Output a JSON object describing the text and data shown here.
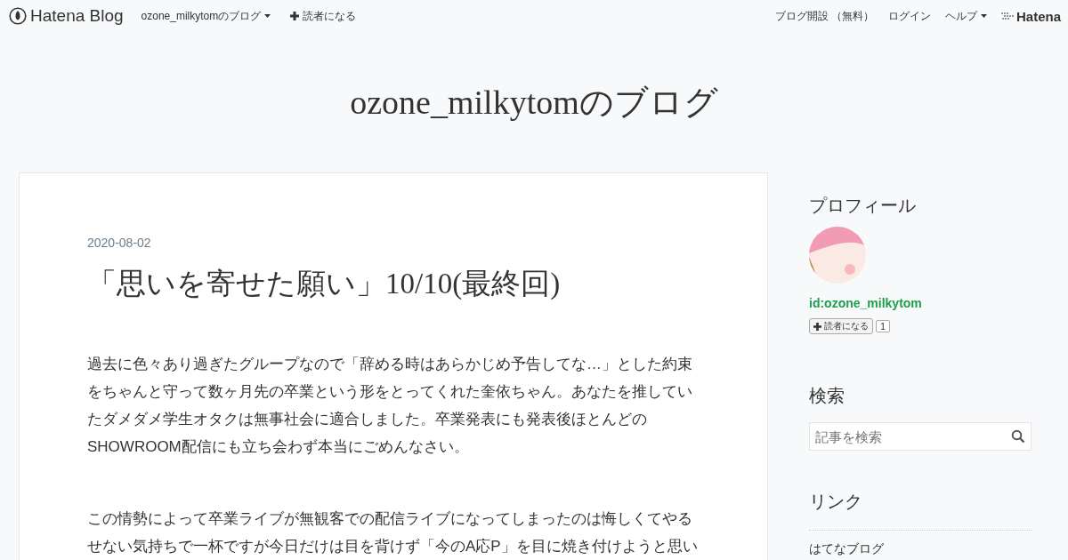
{
  "header": {
    "logo": "Hatena Blog",
    "left_nav": [
      {
        "label": "ozone_milkytomのブログ",
        "kind": "dropdown"
      },
      {
        "label": "読者になる",
        "kind": "plus"
      }
    ],
    "right_nav": [
      {
        "label": "ブログ開設 （無料）",
        "kind": "link"
      },
      {
        "label": "ログイン",
        "kind": "link"
      },
      {
        "label": "ヘルプ",
        "kind": "dropdown"
      }
    ],
    "brand": "Hatena"
  },
  "blog_title": "ozone_milkytomのブログ",
  "article": {
    "date": "2020-08-02",
    "title": "「思いを寄せた願い」10/10(最終回)",
    "paragraphs": [
      "過去に色々あり過ぎたグループなので「辞める時はあらかじめ予告してな…」とした約束をちゃんと守って数ヶ月先の卒業という形をとってくれた奎依ちゃん。あなたを推していたダメダメ学生オタクは無事社会に適合しました。卒業発表にも発表後ほとんどのSHOWROOM配信にも立ち会わず本当にごめんなさい。",
      "この情勢によって卒業ライブが無観客での配信ライブになってしまったのは悔しくてやるせない気持ちで一杯ですが今日だけは目を背けず「今のA応P」を目に焼き付けようと思い"
    ]
  },
  "sidebar": {
    "profile": {
      "heading": "プロフィール",
      "user_id": "id:ozone_milkytom",
      "subscribe_label": "読者になる",
      "subscriber_count": "1"
    },
    "search": {
      "heading": "検索",
      "placeholder": "記事を検索"
    },
    "links": {
      "heading": "リンク",
      "items": [
        "はてなブログ"
      ]
    }
  }
}
